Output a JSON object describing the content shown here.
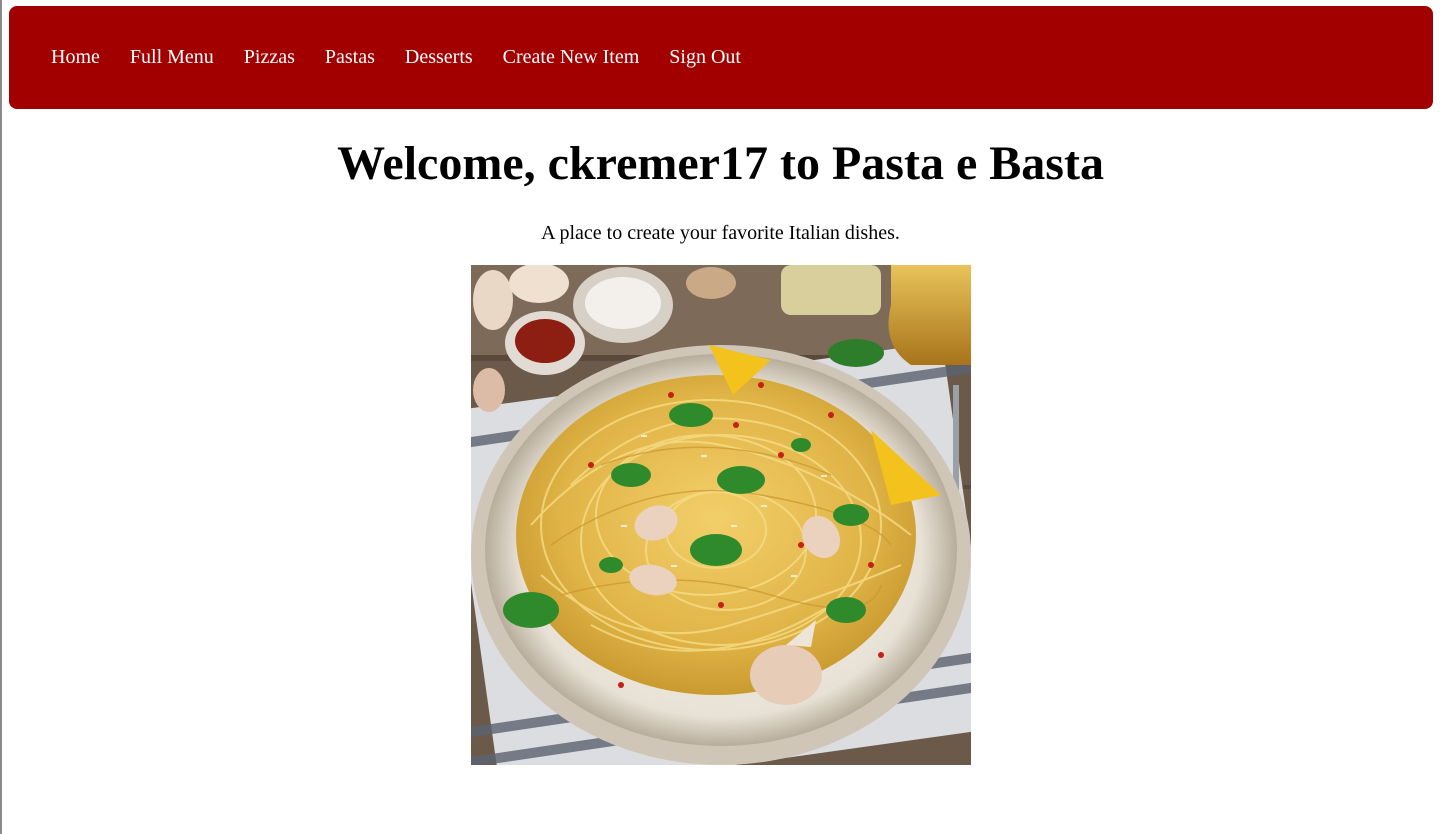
{
  "nav": {
    "items": [
      {
        "label": "Home"
      },
      {
        "label": "Full Menu"
      },
      {
        "label": "Pizzas"
      },
      {
        "label": "Pastas"
      },
      {
        "label": "Desserts"
      },
      {
        "label": "Create New Item"
      },
      {
        "label": "Sign Out"
      }
    ]
  },
  "main": {
    "heading": "Welcome, ckremer17 to Pasta e Basta",
    "tagline": "A place to create your favorite Italian dishes."
  },
  "colors": {
    "navbar_bg": "#a20000",
    "nav_text": "#ffffff"
  },
  "hero_image": {
    "icon": "spaghetti-plate-photo"
  }
}
